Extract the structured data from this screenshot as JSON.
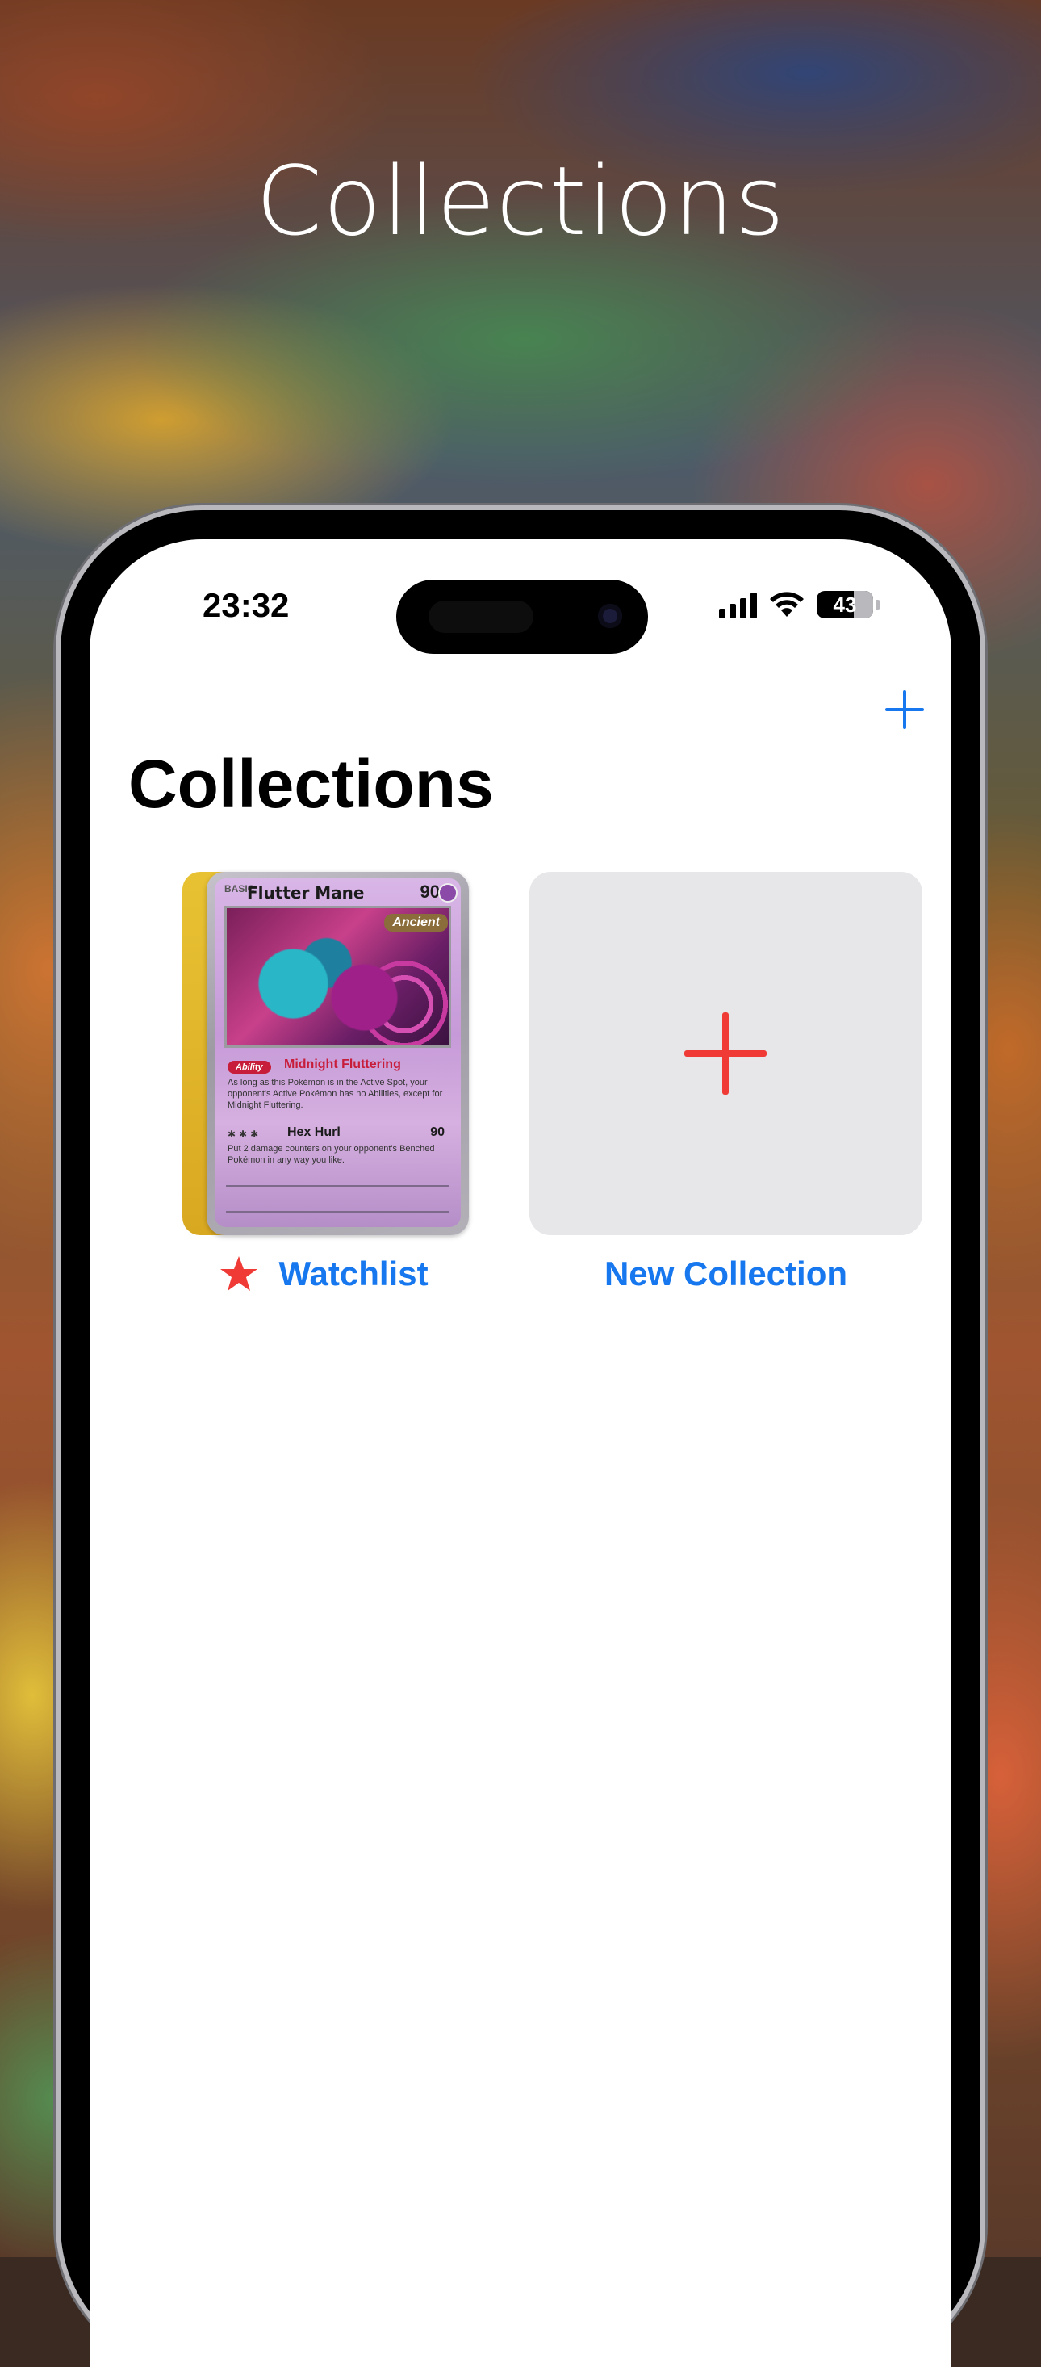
{
  "hero": {
    "title": "Collections"
  },
  "status_bar": {
    "time": "23:32",
    "battery": "43"
  },
  "nav": {
    "title": "Collections",
    "add_icon": "plus-icon"
  },
  "collections": [
    {
      "label": "Watchlist",
      "icon": "star-icon",
      "cover_card": {
        "stage": "BASIC",
        "name": "Flutter Mane",
        "hp": "90",
        "tag": "Ancient",
        "ability_label": "Ability",
        "ability_name": "Midnight Fluttering",
        "ability_text": "As long as this Pokémon is in the Active Spot, your opponent's Active Pokémon has no Abilities, except for Midnight Fluttering.",
        "attack_name": "Hex Hurl",
        "attack_damage": "90",
        "attack_text": "Put 2 damage counters on your opponent's Benched Pokémon in any way you like."
      }
    },
    {
      "label": "New Collection",
      "icon": "plus-icon"
    }
  ],
  "colors": {
    "accent": "#1677ee",
    "plus": "#ef3a36",
    "star": "#ef3a36",
    "tile_bg": "#e7e7ea"
  }
}
